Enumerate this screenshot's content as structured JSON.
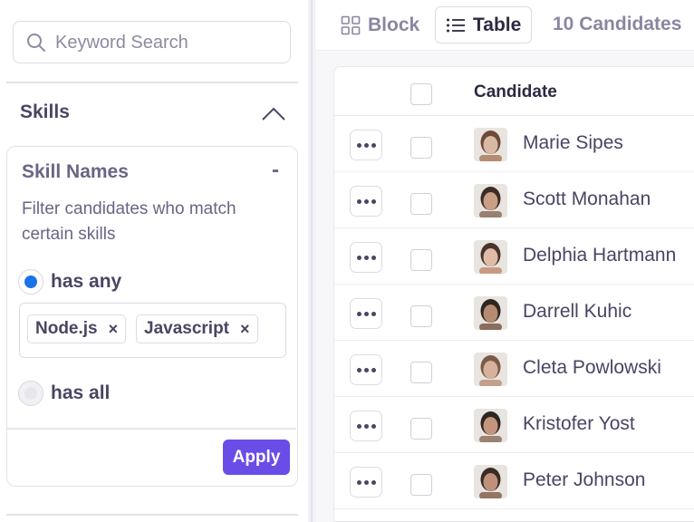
{
  "search": {
    "placeholder": "Keyword Search",
    "value": ""
  },
  "filters": {
    "section_title": "Skills",
    "card": {
      "title": "Skill Names",
      "collapse_symbol": "-",
      "description": "Filter candidates who match certain skills",
      "options": [
        {
          "label": "has any",
          "selected": true
        },
        {
          "label": "has all",
          "selected": false
        }
      ],
      "chips": [
        {
          "label": "Node.js",
          "remove": "×"
        },
        {
          "label": "Javascript",
          "remove": "×"
        }
      ],
      "apply_label": "Apply"
    }
  },
  "toolbar": {
    "tabs": [
      {
        "label": "Block",
        "icon": "grid-icon",
        "active": false
      },
      {
        "label": "Table",
        "icon": "list-icon",
        "active": true
      }
    ],
    "count_label": "10 Candidates"
  },
  "table": {
    "columns": [
      "Candidate"
    ],
    "rows": [
      {
        "name": "Marie Sipes"
      },
      {
        "name": "Scott Monahan"
      },
      {
        "name": "Delphia Hartmann"
      },
      {
        "name": "Darrell Kuhic"
      },
      {
        "name": "Cleta Powlowski"
      },
      {
        "name": "Kristofer Yost"
      },
      {
        "name": "Peter Johnson"
      }
    ]
  },
  "colors": {
    "accent": "#6a4ce7",
    "radio_selected": "#1a73e8",
    "text_dark": "#2c2a40",
    "text_muted": "#8a86a0"
  }
}
